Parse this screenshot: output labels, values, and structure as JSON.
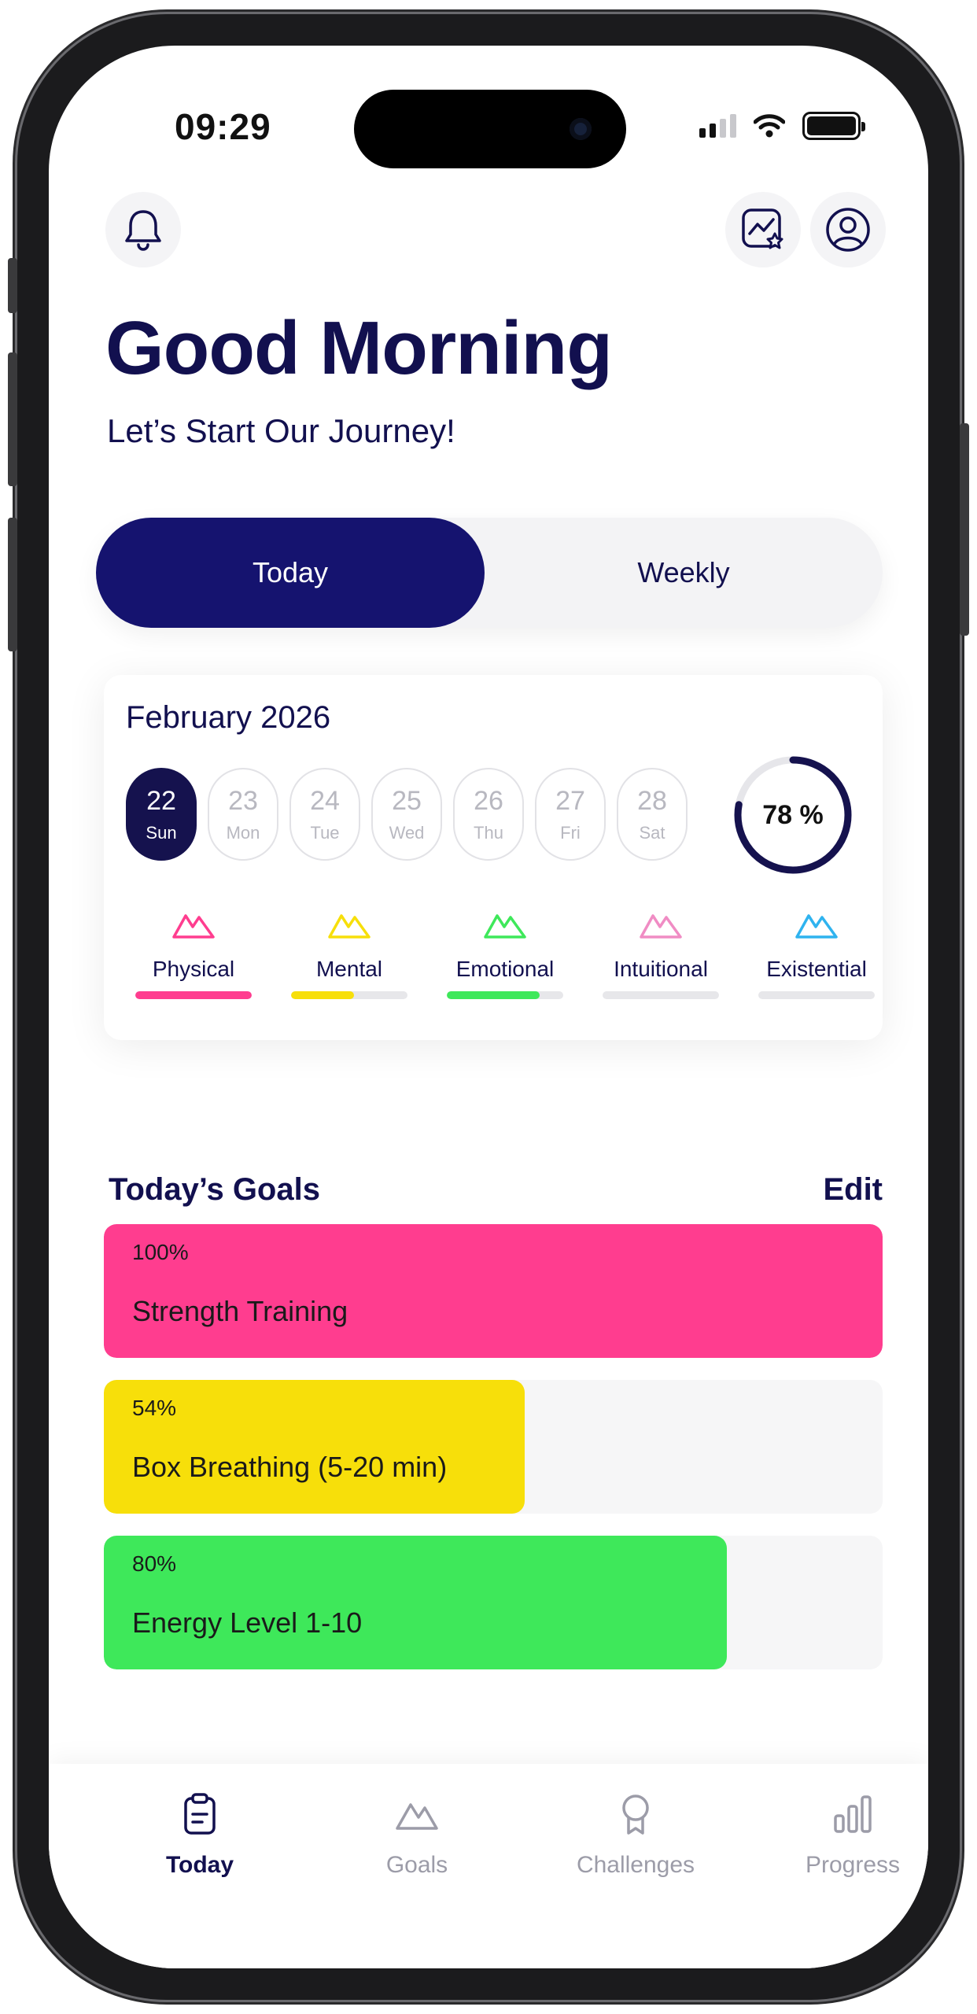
{
  "status": {
    "time": "09:29"
  },
  "header": {
    "greeting": "Good Morning",
    "subtitle": "Let’s Start Our Journey!"
  },
  "toggle": {
    "active": "Today",
    "other": "Weekly"
  },
  "calendar": {
    "month": "February 2026",
    "days": [
      {
        "num": "22",
        "name": "Sun",
        "selected": true
      },
      {
        "num": "23",
        "name": "Mon"
      },
      {
        "num": "24",
        "name": "Tue"
      },
      {
        "num": "25",
        "name": "Wed"
      },
      {
        "num": "26",
        "name": "Thu"
      },
      {
        "num": "27",
        "name": "Fri"
      },
      {
        "num": "28",
        "name": "Sat"
      }
    ],
    "overall_progress": 78,
    "overall_label": "78 %"
  },
  "dimensions": [
    {
      "label": "Physical",
      "color": "#ff3d8f",
      "progress": 100
    },
    {
      "label": "Mental",
      "color": "#f7df0a",
      "progress": 54
    },
    {
      "label": "Emotional",
      "color": "#3ee85a",
      "progress": 80
    },
    {
      "label": "Intuitional",
      "color": "#f08cc4",
      "progress": 0
    },
    {
      "label": "Existential",
      "color": "#2fb3ef",
      "progress": 0
    }
  ],
  "goals": {
    "title": "Today’s Goals",
    "edit": "Edit",
    "items": [
      {
        "percent": "100%",
        "name": "Strength Training",
        "progress": 100,
        "color": "#ff3d8f"
      },
      {
        "percent": "54%",
        "name": "Box Breathing (5-20 min)",
        "progress": 54,
        "color": "#f7df0a"
      },
      {
        "percent": "80%",
        "name": "Energy Level 1-10",
        "progress": 80,
        "color": "#3ee85a"
      }
    ]
  },
  "tabs": [
    {
      "label": "Today",
      "icon": "clipboard-icon",
      "active": true
    },
    {
      "label": "Goals",
      "icon": "mountain-icon"
    },
    {
      "label": "Challenges",
      "icon": "award-icon"
    },
    {
      "label": "Progress",
      "icon": "bar-chart-icon"
    }
  ],
  "colors": {
    "primary": "#15136f",
    "text": "#12104f"
  }
}
